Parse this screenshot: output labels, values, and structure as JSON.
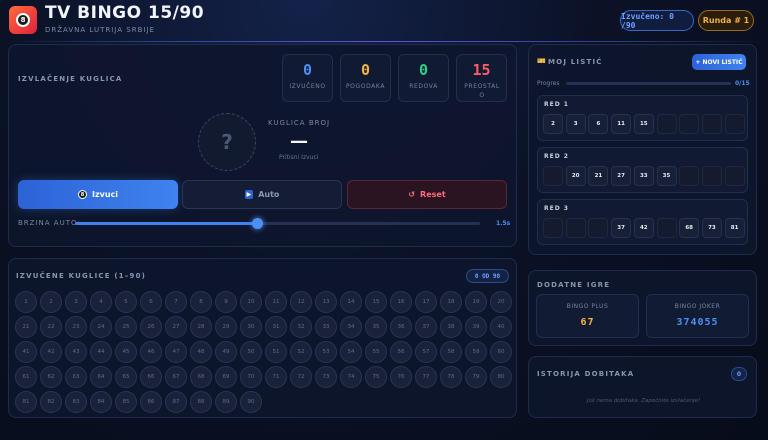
{
  "header": {
    "logo_glyph": "8",
    "title": "TV BINGO 15/90",
    "subtitle": "DRŽAVNA LUTRIJA SRBIJE",
    "drawn_pill": "Izvučeno: 0 /90",
    "round_pill": "Runda # 1"
  },
  "draw_panel": {
    "title": "IZVLAČENJE KUGLICA",
    "stats": [
      {
        "value": "0",
        "label": "IZVUČENO",
        "color": "#4d8ff5"
      },
      {
        "value": "0",
        "label": "POGODAKA",
        "color": "#f2b548"
      },
      {
        "value": "0",
        "label": "REDOVA",
        "color": "#2fd08a"
      },
      {
        "value": "15",
        "label": "PREOSTAL O",
        "color": "#ff5a6b"
      }
    ],
    "ball_placeholder": "?",
    "ball_number_label": "KUGLICA BROJ",
    "ball_number_value": "—",
    "ball_hint": "Pritisni Izvuci",
    "draw_button_icon": "8",
    "draw_button": "Izvuci",
    "auto_button_icon": "▶",
    "auto_button": "Auto",
    "reset_button_icon": "↺",
    "reset_button": "Reset",
    "speed_label": "BRZINA AUTO:",
    "speed_value": "1.5s",
    "speed_fraction": 0.45
  },
  "drawn_grid": {
    "title": "IZVUČENE KUGLICE (1–90)",
    "badge": "0 OD 90",
    "numbers": [
      "1",
      "2",
      "3",
      "4",
      "5",
      "6",
      "7",
      "8",
      "9",
      "10",
      "11",
      "12",
      "13",
      "14",
      "15",
      "16",
      "17",
      "18",
      "19",
      "20",
      "21",
      "22",
      "23",
      "24",
      "25",
      "26",
      "27",
      "28",
      "29",
      "30",
      "31",
      "32",
      "33",
      "34",
      "35",
      "36",
      "37",
      "38",
      "39",
      "40",
      "41",
      "42",
      "43",
      "44",
      "45",
      "46",
      "47",
      "48",
      "49",
      "50",
      "51",
      "52",
      "53",
      "54",
      "55",
      "56",
      "57",
      "58",
      "59",
      "60",
      "61",
      "62",
      "63",
      "64",
      "65",
      "66",
      "67",
      "68",
      "69",
      "70",
      "71",
      "72",
      "73",
      "74",
      "75",
      "76",
      "77",
      "78",
      "79",
      "80",
      "81",
      "82",
      "83",
      "84",
      "85",
      "86",
      "87",
      "88",
      "89",
      "90"
    ]
  },
  "ticket": {
    "title": "MOJ LISTIĆ",
    "new_button": "+ NOVI LISTIĆ",
    "progress_label": "Progres",
    "progress_value": "0/15",
    "progress_fraction": 0,
    "rows": [
      {
        "label": "RED 1",
        "cells": [
          "2",
          "3",
          "6",
          "11",
          "15",
          "",
          "",
          "",
          ""
        ]
      },
      {
        "label": "RED 2",
        "cells": [
          "",
          "20",
          "21",
          "27",
          "33",
          "35",
          "",
          "",
          ""
        ]
      },
      {
        "label": "RED 3",
        "cells": [
          "",
          "",
          "",
          "37",
          "42",
          "",
          "68",
          "73",
          "81"
        ]
      }
    ]
  },
  "extra_games": {
    "title": "DODATNE IGRE",
    "games": [
      {
        "label": "BINGO PLUS",
        "value": "67",
        "color": "#f2b548"
      },
      {
        "label": "BINGO JOKER",
        "value": "374055",
        "color": "#4d8ff5"
      }
    ]
  },
  "history": {
    "title": "ISTORIJA DOBITAKA",
    "badge": "0",
    "empty_text": "Još nema dobitaka. Započnite izvlačenje!"
  }
}
